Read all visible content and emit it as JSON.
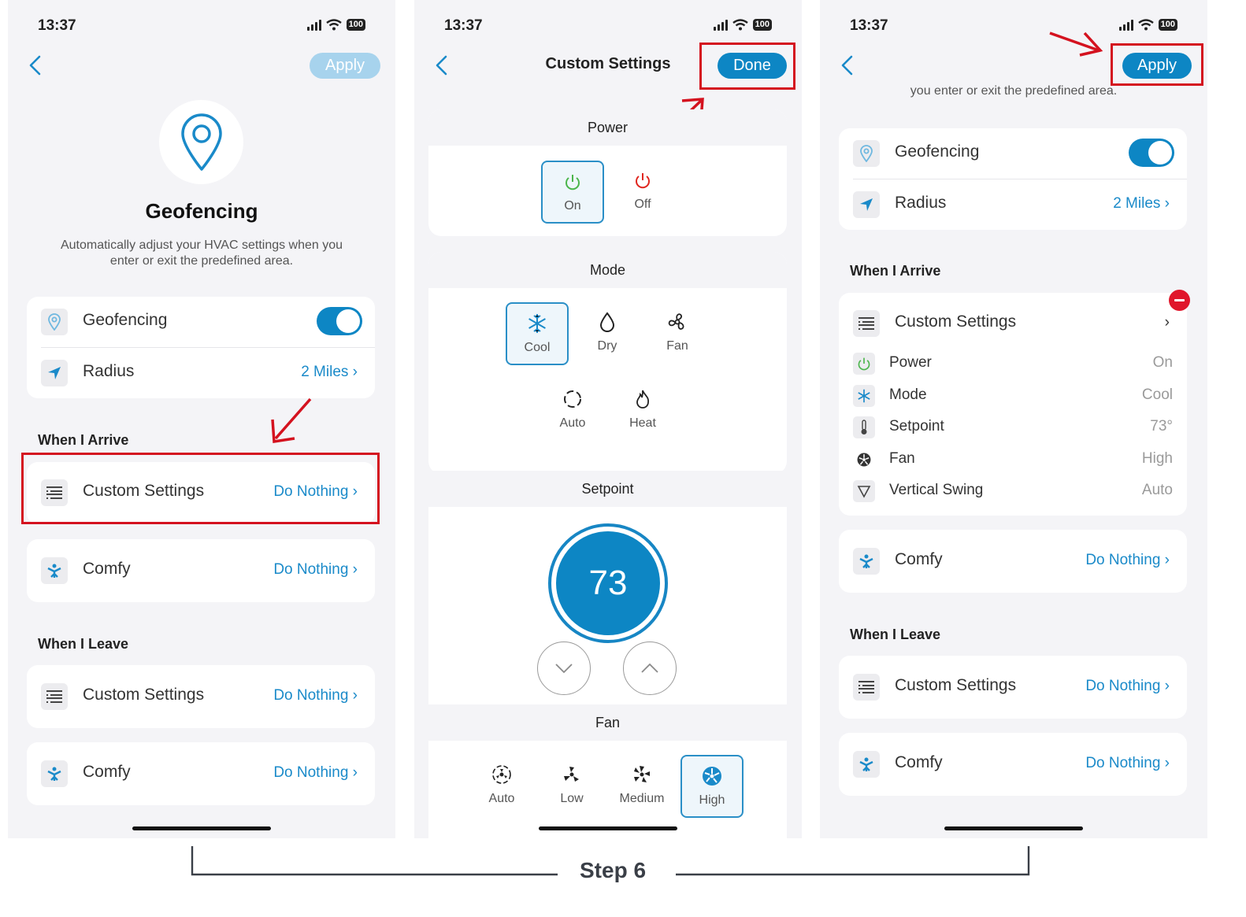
{
  "status": {
    "time": "13:37",
    "battery": "100"
  },
  "phone1": {
    "apply_label": "Apply",
    "title": "Geofencing",
    "description": "Automatically adjust your HVAC settings when you enter or exit the predefined area.",
    "geofencing_label": "Geofencing",
    "radius_label": "Radius",
    "radius_value": "2 Miles",
    "arrive_header": "When I Arrive",
    "arrive_custom_label": "Custom Settings",
    "arrive_custom_value": "Do Nothing",
    "arrive_comfy_label": "Comfy",
    "arrive_comfy_value": "Do Nothing",
    "leave_header": "When I Leave",
    "leave_custom_label": "Custom Settings",
    "leave_custom_value": "Do Nothing",
    "leave_comfy_label": "Comfy",
    "leave_comfy_value": "Do Nothing"
  },
  "phone2": {
    "title": "Custom Settings",
    "done_label": "Done",
    "power_header": "Power",
    "power_on": "On",
    "power_off": "Off",
    "mode_header": "Mode",
    "modes": [
      "Cool",
      "Dry",
      "Fan",
      "Auto",
      "Heat"
    ],
    "mode_selected": "Cool",
    "setpoint_header": "Setpoint",
    "setpoint_value": "73",
    "fan_header": "Fan",
    "fans": [
      "Auto",
      "Low",
      "Medium",
      "High"
    ],
    "fan_selected": "High"
  },
  "phone3": {
    "apply_label": "Apply",
    "description_partial": "you enter or exit the predefined area.",
    "geofencing_label": "Geofencing",
    "radius_label": "Radius",
    "radius_value": "2 Miles",
    "arrive_header": "When I Arrive",
    "custom_label": "Custom Settings",
    "details": [
      {
        "label": "Power",
        "value": "On"
      },
      {
        "label": "Mode",
        "value": "Cool"
      },
      {
        "label": "Setpoint",
        "value": "73°"
      },
      {
        "label": "Fan",
        "value": "High"
      },
      {
        "label": "Vertical Swing",
        "value": "Auto"
      }
    ],
    "arrive_comfy_label": "Comfy",
    "arrive_comfy_value": "Do Nothing",
    "leave_header": "When I Leave",
    "leave_custom_label": "Custom Settings",
    "leave_custom_value": "Do Nothing",
    "leave_comfy_label": "Comfy",
    "leave_comfy_value": "Do Nothing"
  },
  "step_label": "Step 6",
  "colors": {
    "accent": "#0d86c4",
    "link": "#1a8ac9",
    "highlight": "#d4121f",
    "background": "#f4f4f7"
  }
}
